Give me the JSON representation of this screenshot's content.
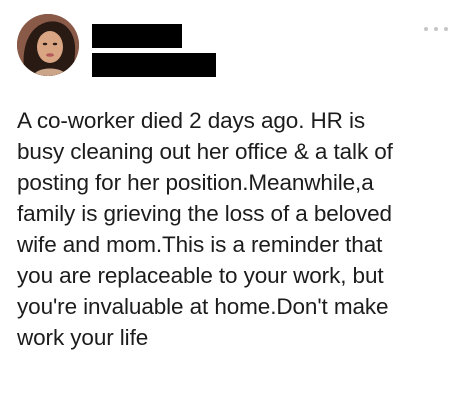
{
  "post": {
    "text_lines": [
      "A co-worker died 2 days ago. HR is",
      "busy cleaning out her office & a talk of",
      "posting for her position.Meanwhile,a",
      "family is grieving the loss of a beloved",
      "wife and mom.This is a reminder that",
      "you are replaceable to your work, but",
      "you're invaluable at home.Don't make",
      "work your life"
    ],
    "more_icon": "more-dots-icon",
    "avatar_icon": "profile-photo",
    "colors": {
      "text": "#1c1c1c",
      "redaction": "#000000",
      "more_dots": "#c6c6c6"
    }
  }
}
